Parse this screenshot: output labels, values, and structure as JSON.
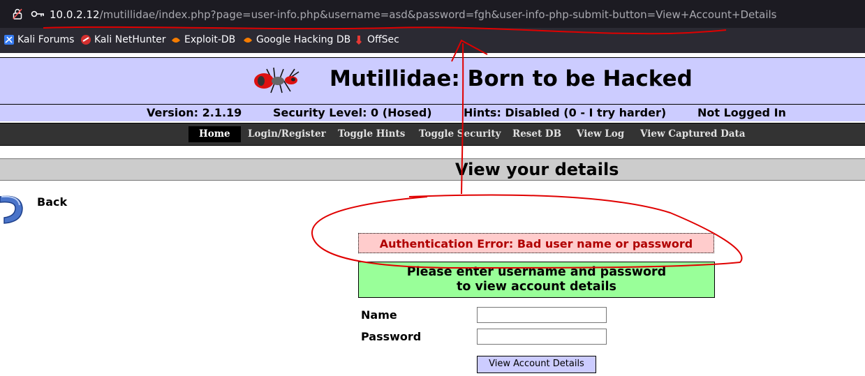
{
  "browser": {
    "url_host": "10.0.2.12",
    "url_path": "/mutillidae/index.php?page=user-info.php&username=asd&password=fgh&user-info-php-submit-button=View+Account+Details"
  },
  "bookmarks": [
    {
      "label": "Kali Forums",
      "icon": "kali-forums-icon"
    },
    {
      "label": "Kali NetHunter",
      "icon": "kali-nethunter-icon"
    },
    {
      "label": "Exploit-DB",
      "icon": "exploit-db-icon"
    },
    {
      "label": "Google Hacking DB",
      "icon": "google-hacking-db-icon"
    },
    {
      "label": "OffSec",
      "icon": "offsec-icon"
    }
  ],
  "site": {
    "title": "Mutillidae: Born to be Hacked",
    "version": "Version: 2.1.19",
    "security": "Security Level: 0 (Hosed)",
    "hints": "Hints: Disabled (0 - I try harder)",
    "login_status": "Not Logged In"
  },
  "nav": [
    "Home",
    "Login/Register",
    "Toggle Hints",
    "Toggle Security",
    "Reset DB",
    "View Log",
    "View Captured Data"
  ],
  "page": {
    "heading": "View your details",
    "back_label": "Back",
    "error": "Authentication Error: Bad user name or password",
    "prompt_line1": "Please enter username and password",
    "prompt_line2": "to view account details",
    "name_label": "Name",
    "password_label": "Password",
    "name_value": "",
    "password_value": "",
    "submit_label": "View Account Details"
  },
  "colors": {
    "header_bg": "#ccccff",
    "nav_bg": "#333333",
    "error_bg": "#ffcccc",
    "error_text": "#b00000",
    "prompt_bg": "#99ff99",
    "annotation": "#e00000"
  }
}
